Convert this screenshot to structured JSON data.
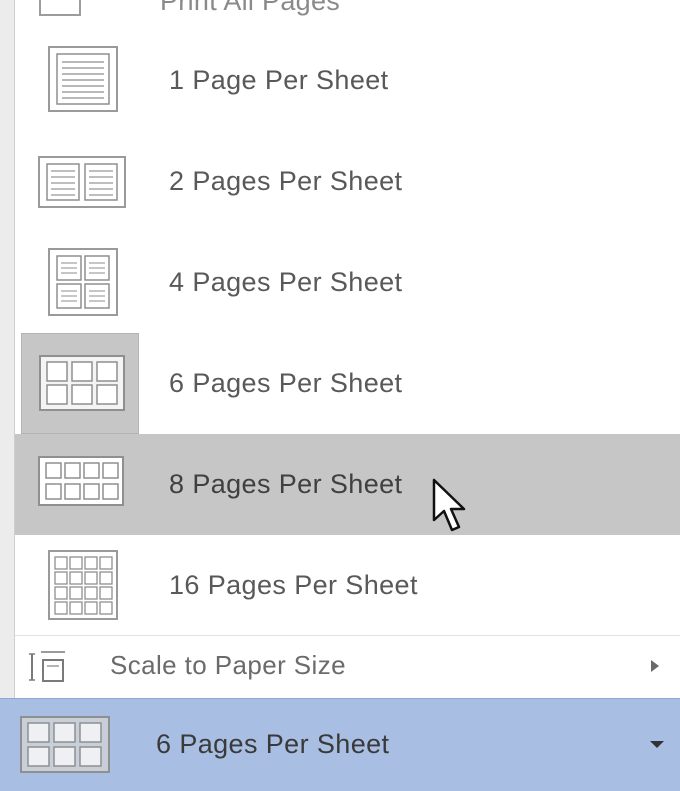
{
  "menu": {
    "cut_top_label": "Print All Pages",
    "items": [
      {
        "label": "1 Page Per Sheet",
        "icon": "one-page-icon"
      },
      {
        "label": "2 Pages Per Sheet",
        "icon": "two-pages-icon"
      },
      {
        "label": "4 Pages Per Sheet",
        "icon": "four-pages-icon"
      },
      {
        "label": "6 Pages Per Sheet",
        "icon": "six-pages-icon",
        "selected": true
      },
      {
        "label": "8 Pages Per Sheet",
        "icon": "eight-pages-icon",
        "hovered": true
      },
      {
        "label": "16 Pages Per Sheet",
        "icon": "sixteen-pages-icon"
      }
    ],
    "scale": {
      "label": "Scale to Paper Size",
      "icon": "scale-icon",
      "submenu_arrow": "chevron-right-icon"
    }
  },
  "dropdown": {
    "label": "6 Pages Per Sheet",
    "icon": "six-pages-icon",
    "caret": "chevron-down-icon"
  },
  "colors": {
    "hover": "#c6c6c6",
    "dropdown_bg": "#a9bee3",
    "icon_stroke": "#8f8f8f"
  }
}
